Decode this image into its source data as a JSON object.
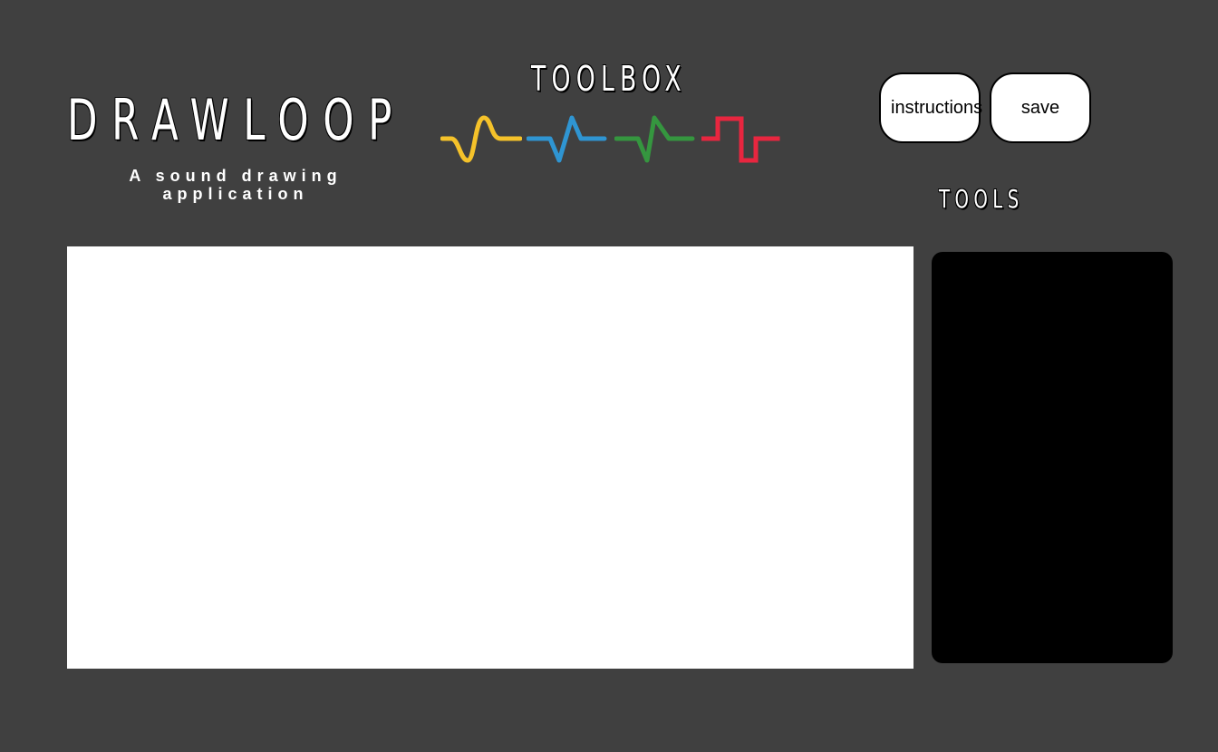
{
  "app": {
    "title": "DRAWLOOP",
    "subtitle": "A sound drawing application"
  },
  "toolbox": {
    "title": "TOOLBOX",
    "waves": [
      {
        "name": "sine-wave",
        "color": "#f5c22a"
      },
      {
        "name": "pulse-wave",
        "color": "#2f95d2"
      },
      {
        "name": "sawtooth-wave",
        "color": "#35963f"
      },
      {
        "name": "square-wave",
        "color": "#e8263f"
      }
    ]
  },
  "buttons": {
    "instructions_label": "instructions",
    "save_label": "save"
  },
  "tools": {
    "title": "TOOLS"
  },
  "colors": {
    "background": "#404040",
    "canvas": "#ffffff",
    "tools_panel": "#000000"
  }
}
